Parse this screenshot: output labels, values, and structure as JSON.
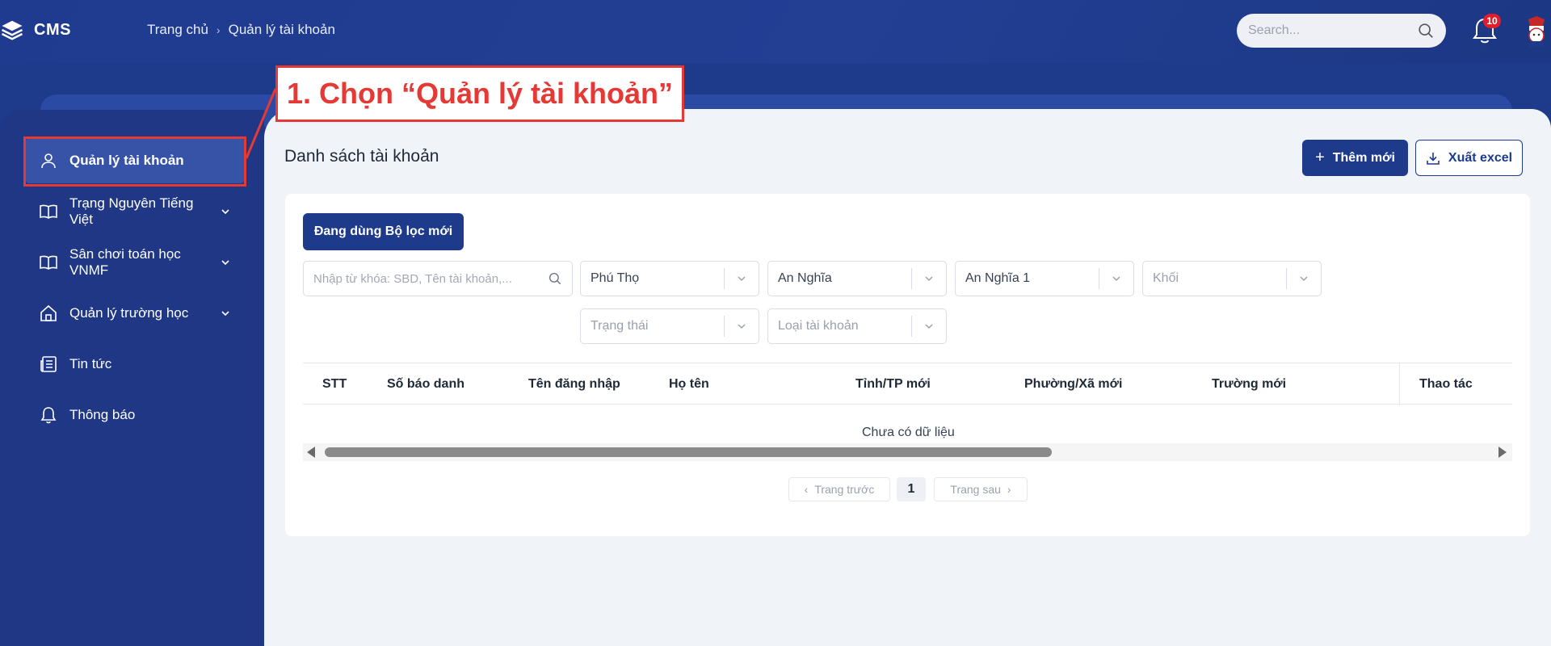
{
  "header": {
    "brand": "CMS",
    "breadcrumb": [
      "Trang chủ",
      "Quản lý tài khoản"
    ],
    "search_placeholder": "Search...",
    "notification_count": "10"
  },
  "annotation": {
    "label": "1. Chọn “Quản lý tài khoản”"
  },
  "sidebar": {
    "items": [
      {
        "label": "Quản lý tài khoản",
        "icon": "user-icon",
        "active": true
      },
      {
        "label": "Trạng Nguyên Tiếng Việt",
        "icon": "book-icon",
        "expandable": true
      },
      {
        "label": "Sân chơi toán học VNMF",
        "icon": "book-icon",
        "expandable": true
      },
      {
        "label": "Quản lý trường học",
        "icon": "home-icon",
        "expandable": true
      },
      {
        "label": "Tin tức",
        "icon": "news-icon"
      },
      {
        "label": "Thông báo",
        "icon": "bell-icon"
      }
    ]
  },
  "main": {
    "title": "Danh sách tài khoản",
    "add_button": "Thêm mới",
    "export_button": "Xuất excel",
    "filter_button": "Đang dùng Bộ lọc mới",
    "keyword_placeholder": "Nhập từ khóa: SBD, Tên tài khoản,...",
    "filters": {
      "province": "Phú Thọ",
      "ward": "An Nghĩa",
      "school": "An Nghĩa 1",
      "grade": "Khối",
      "status": "Trạng thái",
      "account_type": "Loại tài khoản"
    },
    "table": {
      "columns": [
        "STT",
        "Số báo danh",
        "Tên đăng nhập",
        "Họ tên",
        "Tỉnh/TP mới",
        "Phường/Xã mới",
        "Trường mới",
        "Thao tác"
      ],
      "empty_text": "Chưa có dữ liệu"
    },
    "pagination": {
      "prev": "Trang trước",
      "current": "1",
      "next": "Trang sau"
    }
  },
  "colors": {
    "primary": "#1e3a8a",
    "annotation": "#e53935",
    "badge": "#e11d2e"
  }
}
